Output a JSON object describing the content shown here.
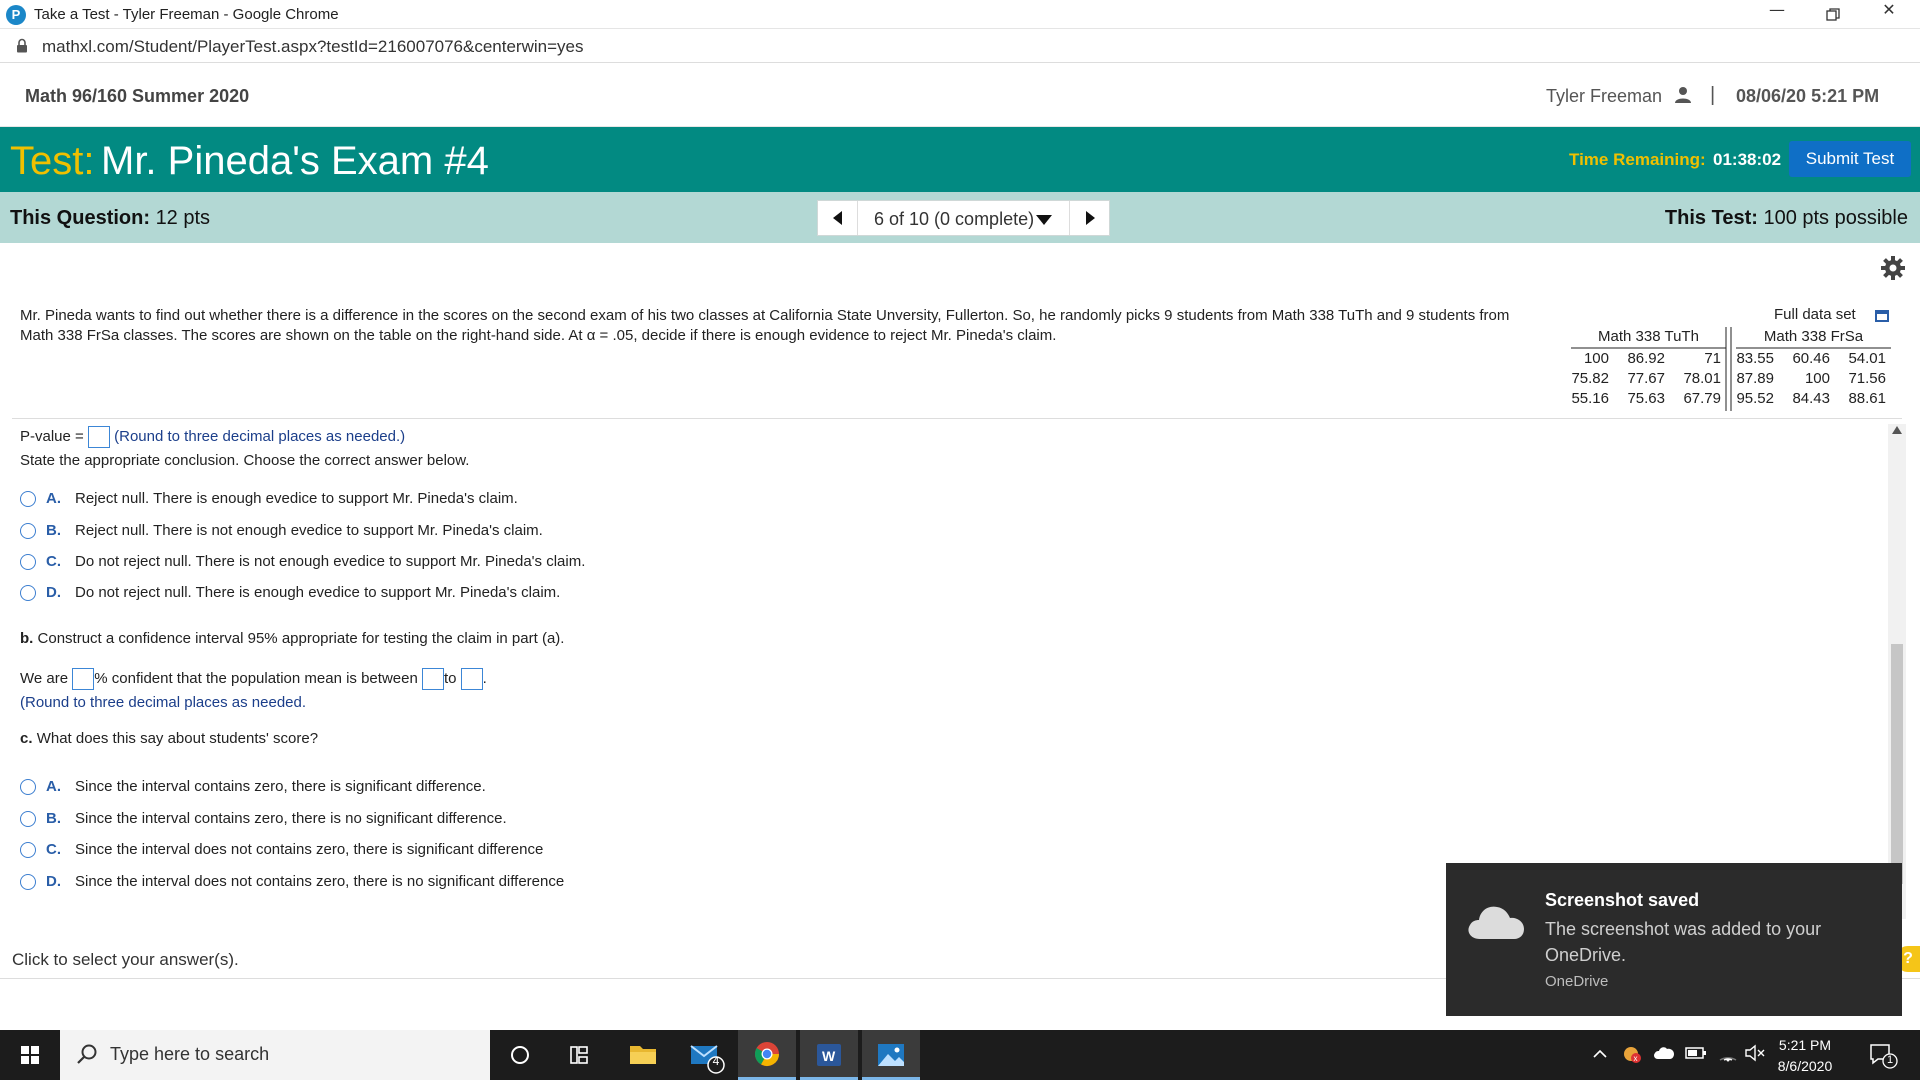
{
  "browser": {
    "window_title": "Take a Test - Tyler Freeman - Google Chrome",
    "url": "mathxl.com/Student/PlayerTest.aspx?testId=216007076&centerwin=yes"
  },
  "course_header": {
    "course": "Math 96/160 Summer 2020",
    "user": "Tyler Freeman",
    "separator": "|",
    "datetime": "08/06/20 5:21 PM"
  },
  "test_header": {
    "label": "Test:",
    "name": "Mr. Pineda's Exam #4",
    "time_label": "Time Remaining:",
    "time_value": "01:38:02",
    "submit_label": "Submit Test"
  },
  "question_bar": {
    "this_question_label": "This Question:",
    "this_question_pts": "12 pts",
    "navigator": "6 of 10 (0 complete)",
    "this_test_label": "This Test:",
    "this_test_pts": "100 pts possible"
  },
  "problem": {
    "text": "Mr. Pineda wants to find out whether there is a difference in the scores on the second exam of his two classes at California State Unversity, Fullerton. So, he randomly picks 9 students from Math 338 TuTh and 9 students from Math 338 FrSa classes. The scores are shown on the table on the right-hand side. At α = .05, decide if there is enough evidence to reject Mr. Pineda's claim.",
    "full_data_label": "Full data set"
  },
  "data_table": {
    "headers": [
      "Math 338 TuTh",
      "Math 338 FrSa"
    ],
    "left_rows": [
      [
        "100",
        "86.92",
        "71"
      ],
      [
        "75.82",
        "77.67",
        "78.01"
      ],
      [
        "55.16",
        "75.63",
        "67.79"
      ]
    ],
    "right_rows": [
      [
        "83.55",
        "60.46",
        "54.01"
      ],
      [
        "87.89",
        "100",
        "71.56"
      ],
      [
        "95.52",
        "84.43",
        "88.61"
      ]
    ]
  },
  "part_a": {
    "pvalue_label": "P-value =",
    "pvalue_hint": "(Round to three decimal places as needed.)",
    "prompt": "State the appropriate conclusion. Choose the correct answer below.",
    "options": [
      {
        "letter": "A.",
        "text": "Reject null. There is enough evedice to support Mr. Pineda's claim."
      },
      {
        "letter": "B.",
        "text": "Reject null. There is not enough evedice to support Mr. Pineda's claim."
      },
      {
        "letter": "C.",
        "text": "Do not reject null. There is not enough evedice to support Mr. Pineda's claim."
      },
      {
        "letter": "D.",
        "text": "Do not reject null. There is enough evedice to support Mr. Pineda's claim."
      }
    ]
  },
  "part_b": {
    "label": "b.",
    "prompt": "Construct a confidence interval 95% appropriate for testing the claim in part (a).",
    "we_are": "We are",
    "confident": "% confident that the population mean is between",
    "to": "to",
    "period": ".",
    "hint": "(Round to three decimal places as needed."
  },
  "part_c": {
    "label": "c.",
    "prompt": "What does this say about students' score?",
    "options": [
      {
        "letter": "A.",
        "text": "Since the interval contains zero, there is significant difference."
      },
      {
        "letter": "B.",
        "text": "Since the interval contains zero, there is no significant difference."
      },
      {
        "letter": "C.",
        "text": "Since the interval does not contains zero, there is significant difference"
      },
      {
        "letter": "D.",
        "text": "Since the interval does not contains zero, there is no significant difference"
      }
    ]
  },
  "footer": {
    "click_hint": "Click to select your answer(s)."
  },
  "toast": {
    "title": "Screenshot saved",
    "body": "The screenshot was added to your OneDrive.",
    "source": "OneDrive"
  },
  "taskbar": {
    "search_placeholder": "Type here to search",
    "mail_badge": "4",
    "time": "5:21 PM",
    "date": "8/6/2020",
    "notification_count": "1"
  },
  "colors": {
    "test_header_bg": "#028a82",
    "test_label": "#f0c000",
    "question_bar_bg": "#b3d8d4",
    "submit_button": "#0f6fc6",
    "option_letter": "#2a5ea8"
  }
}
